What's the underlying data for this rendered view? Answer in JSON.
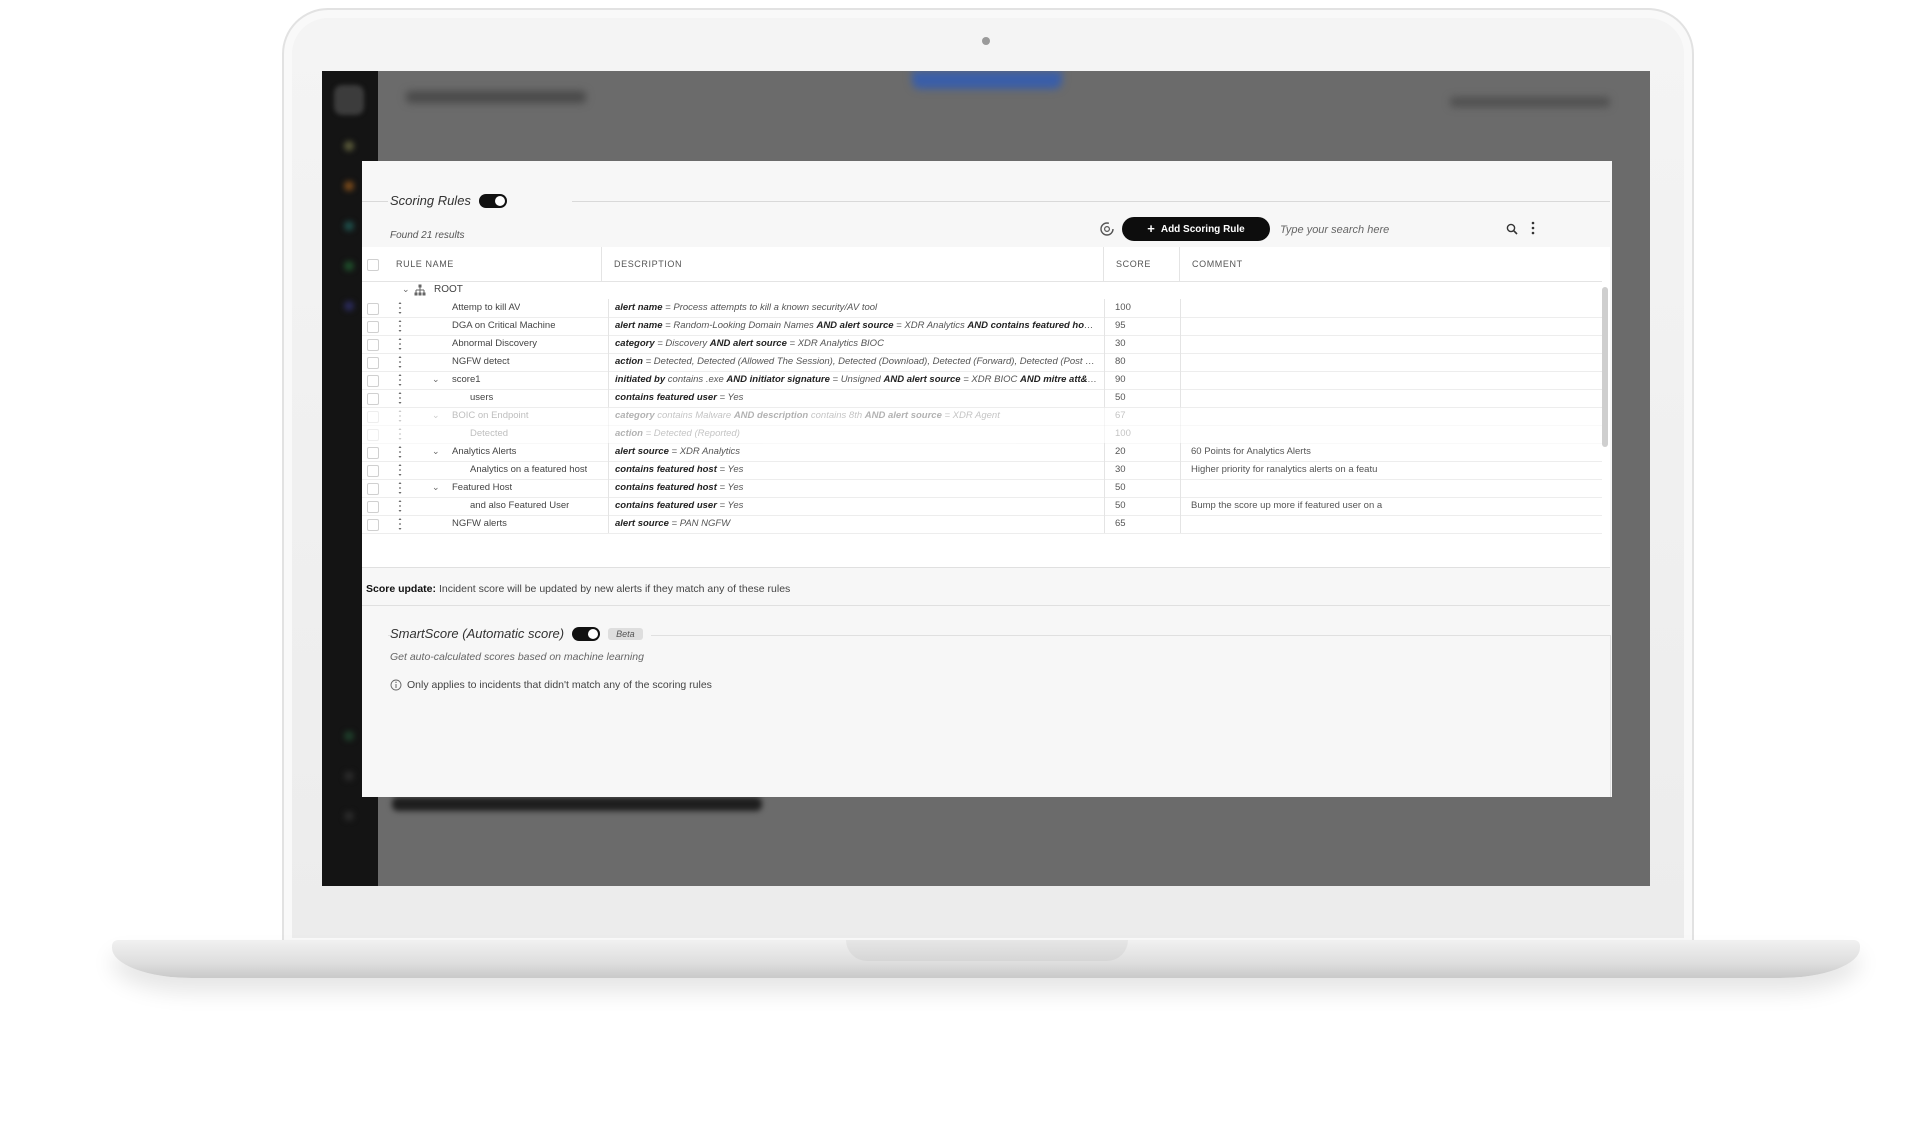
{
  "scoring_rules": {
    "title": "Scoring Rules",
    "found_text": "Found 21 results",
    "add_button_label": "Add Scoring Rule",
    "search_placeholder": "Type your search here",
    "columns": [
      "RULE NAME",
      "DESCRIPTION",
      "SCORE",
      "COMMENT"
    ],
    "root_label": "ROOT",
    "rows": [
      {
        "name": "Attemp to kill AV",
        "desc_html": "<b>alert name</b> = Process attempts to kill a known security/AV tool",
        "score": "100",
        "comment": ""
      },
      {
        "name": "DGA on Critical Machine",
        "desc_html": "<b>alert name</b> = Random-Looking Domain Names <b>AND alert source</b> = XDR Analytics <b>AND contains featured host</b> = Yes",
        "score": "95",
        "comment": ""
      },
      {
        "name": "Abnormal Discovery",
        "desc_html": "<b>category</b> = Discovery <b>AND alert source</b> = XDR Analytics BIOC",
        "score": "30",
        "comment": ""
      },
      {
        "name": "NGFW detect",
        "desc_html": "<b>action</b> = Detected, Detected (Allowed The Session), Detected (Download), Detected (Forward), Detected (Post Detected), Detec...",
        "score": "80",
        "comment": ""
      },
      {
        "name": "score1",
        "desc_html": "<b>initiated by</b> contains .exe <b>AND initiator signature</b> = Unsigned <b>AND alert source</b> = XDR BIOC <b>AND mitre att&amp;ck tactic</b> contains ...",
        "score": "90",
        "comment": ""
      },
      {
        "name": "users",
        "desc_html": "<b>contains featured user</b> = Yes",
        "score": "50",
        "comment": ""
      },
      {
        "name": "BOIC on Endpoint",
        "desc_html": "<b>category</b> contains Malware <b>AND description</b> contains 8th <b>AND alert source</b> = XDR Agent",
        "score": "67",
        "comment": ""
      },
      {
        "name": "Detected",
        "desc_html": "<b>action</b> = Detected (Reported)",
        "score": "100",
        "comment": ""
      },
      {
        "name": "Analytics Alerts",
        "desc_html": "<b>alert source</b> = XDR Analytics",
        "score": "20",
        "comment": "60 Points for Analytics Alerts"
      },
      {
        "name": "Analytics on a featured host",
        "desc_html": "<b>contains featured host</b> = Yes",
        "score": "30",
        "comment": "Higher priority for ranalytics alerts on a featu"
      },
      {
        "name": "Featured Host",
        "desc_html": "<b>contains featured host</b> = Yes",
        "score": "50",
        "comment": ""
      },
      {
        "name": "and also Featured User",
        "desc_html": "<b>contains featured user</b> = Yes",
        "score": "50",
        "comment": "Bump the score up more if featured user on a"
      },
      {
        "name": "NGFW alerts",
        "desc_html": "<b>alert source</b> = PAN NGFW",
        "score": "65",
        "comment": ""
      }
    ],
    "score_update_label": "Score update:",
    "score_update_text": "Incident score will be updated by new alerts if they match any of these rules"
  },
  "smart_score": {
    "title": "SmartScore (Automatic score)",
    "badge": "Beta",
    "subtitle": "Get auto-calculated scores based on machine learning",
    "info_text": "Only applies to incidents that didn't match any of the scoring rules"
  }
}
